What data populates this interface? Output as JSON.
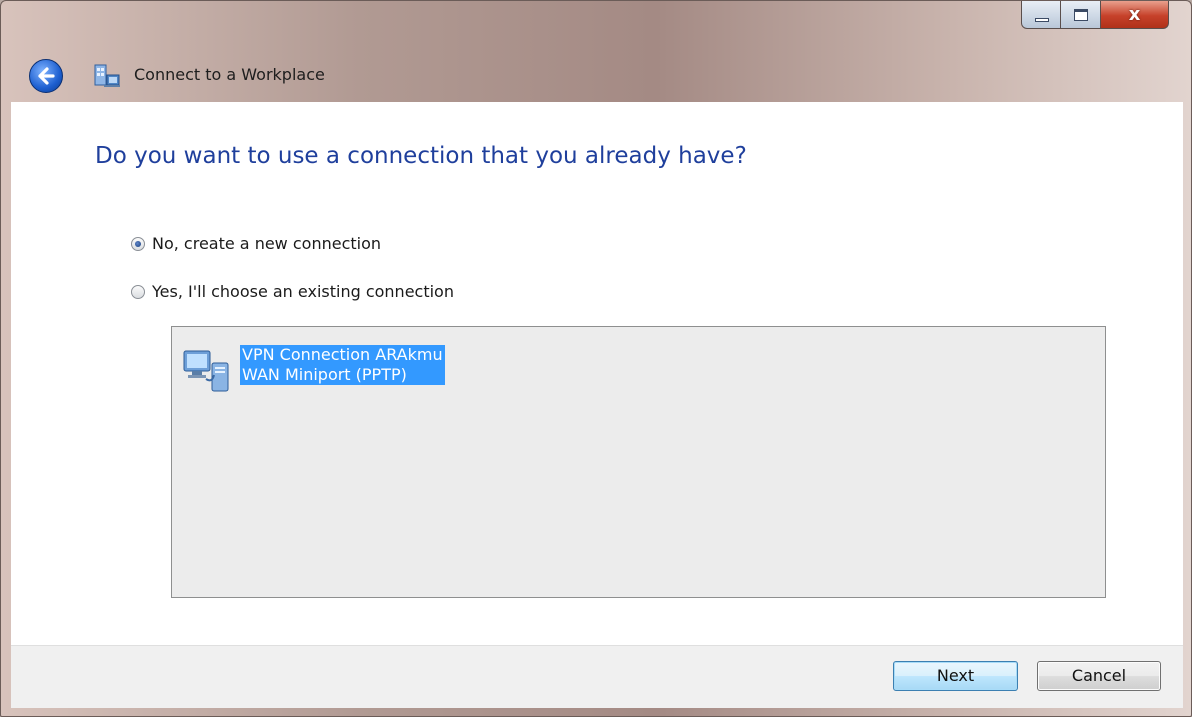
{
  "window": {
    "title": "Connect to a Workplace",
    "caption_close": "x"
  },
  "content": {
    "heading": "Do you want to use a connection that you already have?",
    "options": [
      {
        "label": "No, create a new connection",
        "selected": true
      },
      {
        "label": "Yes, I'll choose an existing connection",
        "selected": false
      }
    ],
    "connections": [
      {
        "name": "VPN Connection ARAkmu",
        "device": "WAN Miniport (PPTP)",
        "selected": true,
        "icon": "vpn-network-icon"
      }
    ]
  },
  "footer": {
    "next_label": "Next",
    "cancel_label": "Cancel"
  },
  "colors": {
    "heading": "#1f3f9c",
    "selection": "#3399ff"
  }
}
